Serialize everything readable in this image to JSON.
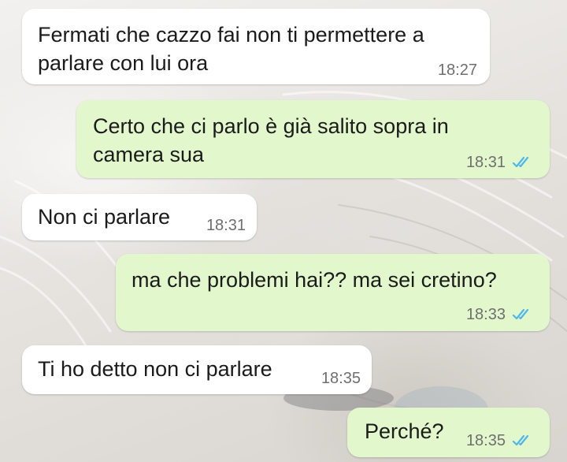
{
  "messages": [
    {
      "direction": "in",
      "text": "Fermati che cazzo fai non ti permettere a\nparlare con lui ora",
      "time": "18:27"
    },
    {
      "direction": "out",
      "text": "Certo che ci parlo è già salito sopra in\ncamera sua",
      "time": "18:31",
      "status_icon": "double-check-read-icon"
    },
    {
      "direction": "in",
      "text": "Non ci parlare",
      "time": "18:31"
    },
    {
      "direction": "out",
      "text": "ma che problemi hai?? ma sei cretino?",
      "time": "18:33",
      "status_icon": "double-check-read-icon"
    },
    {
      "direction": "in",
      "text": "Ti ho detto non ci parlare",
      "time": "18:35"
    },
    {
      "direction": "out",
      "text": "Perché?",
      "time": "18:35",
      "status_icon": "double-check-read-icon"
    }
  ],
  "colors": {
    "incoming_bubble": "#ffffff",
    "outgoing_bubble": "#e2f8cc",
    "read_ticks": "#4fb6ec",
    "timestamp": "#6f6f6f"
  }
}
